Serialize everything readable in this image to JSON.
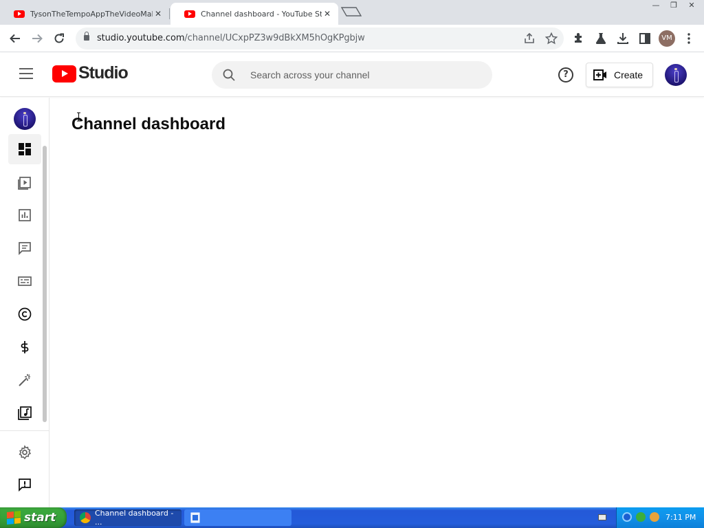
{
  "browser": {
    "tabs": [
      {
        "title": "TysonTheTempoAppTheVideoMaker -",
        "close": "✕",
        "active": false
      },
      {
        "title": "Channel dashboard - YouTube Studio",
        "close": "✕",
        "active": true
      }
    ],
    "url_host": "studio.youtube.com",
    "url_path": "/channel/UCxpPZ3w9dBkXM5hOgKPgbjw",
    "profile_initials": "VM",
    "window_controls": [
      "—",
      "❐",
      "✕"
    ]
  },
  "studio_header": {
    "logo_text": "Studio",
    "search_placeholder": "Search across your channel",
    "help_label": "?",
    "create_label": "Create"
  },
  "rail_items": [
    {
      "name": "dashboard",
      "icon": "dashboard-icon",
      "active": true
    },
    {
      "name": "content",
      "icon": "content-icon"
    },
    {
      "name": "analytics",
      "icon": "analytics-icon"
    },
    {
      "name": "comments",
      "icon": "comments-icon"
    },
    {
      "name": "subtitles",
      "icon": "subtitles-icon"
    },
    {
      "name": "copyright",
      "icon": "copyright-icon"
    },
    {
      "name": "earn",
      "icon": "dollar-icon"
    },
    {
      "name": "customization",
      "icon": "magic-wand-icon"
    },
    {
      "name": "audio-library",
      "icon": "music-library-icon"
    },
    {
      "name": "settings",
      "icon": "gear-icon"
    },
    {
      "name": "send-feedback",
      "icon": "feedback-icon"
    }
  ],
  "main": {
    "page_title": "Channel dashboard"
  },
  "taskbar": {
    "start_label": "start",
    "active_task": "Channel dashboard - ...",
    "clock": "7:11 PM"
  },
  "colors": {
    "youtube_red": "#ff0000",
    "xp_taskbar": "#245ddb",
    "xp_start_green": "#36a23a",
    "xp_tray": "#1290e8"
  }
}
